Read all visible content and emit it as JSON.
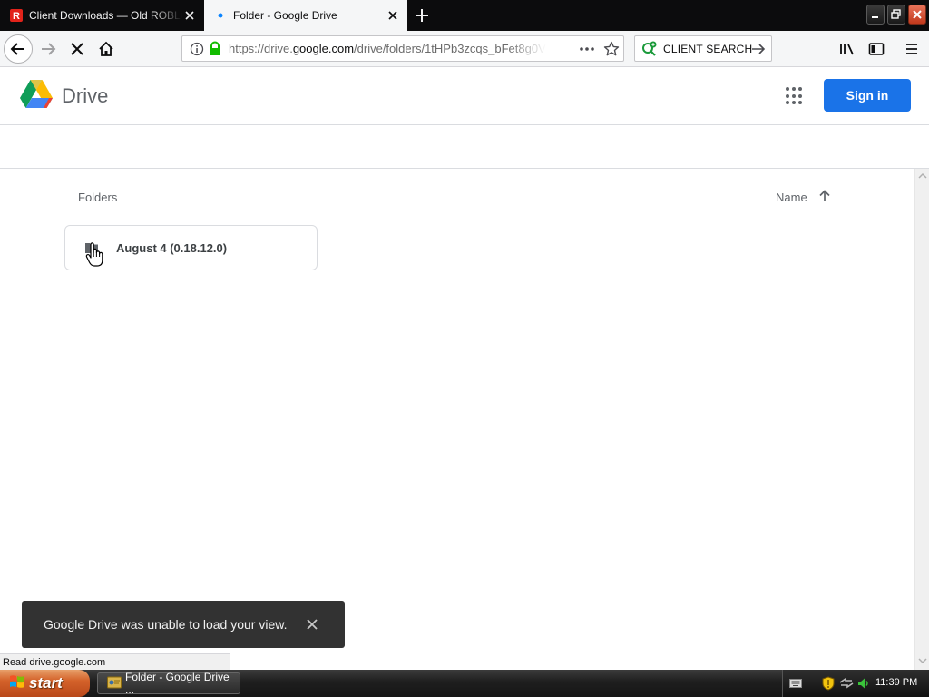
{
  "browser": {
    "tabs": [
      {
        "title": "Client Downloads — Old ROBLOX C",
        "active": false
      },
      {
        "title": "Folder - Google Drive",
        "active": true
      }
    ],
    "url": {
      "prefix": "https://drive.",
      "domain": "google.com",
      "path": "/drive/folders/1tHPb3zcqs_bFet8g0V"
    },
    "search": {
      "label": "CLIENT SEARCH"
    },
    "status": "Read drive.google.com"
  },
  "drive": {
    "brand": "Drive",
    "sign_in": "Sign in",
    "folders_heading": "Folders",
    "sort_label": "Name",
    "folders": [
      {
        "name": "August 4 (0.18.12.0)"
      }
    ],
    "toast": "Google Drive was unable to load your view."
  },
  "taskbar": {
    "start_label": "start",
    "tasks": [
      {
        "label": "Folder - Google Drive ..."
      }
    ],
    "clock": "11:39 PM"
  },
  "colors": {
    "drive_blue": "#1a73e8",
    "toast_bg": "#323232",
    "start_orange": "#d4622a",
    "close_red": "#c1391c"
  }
}
